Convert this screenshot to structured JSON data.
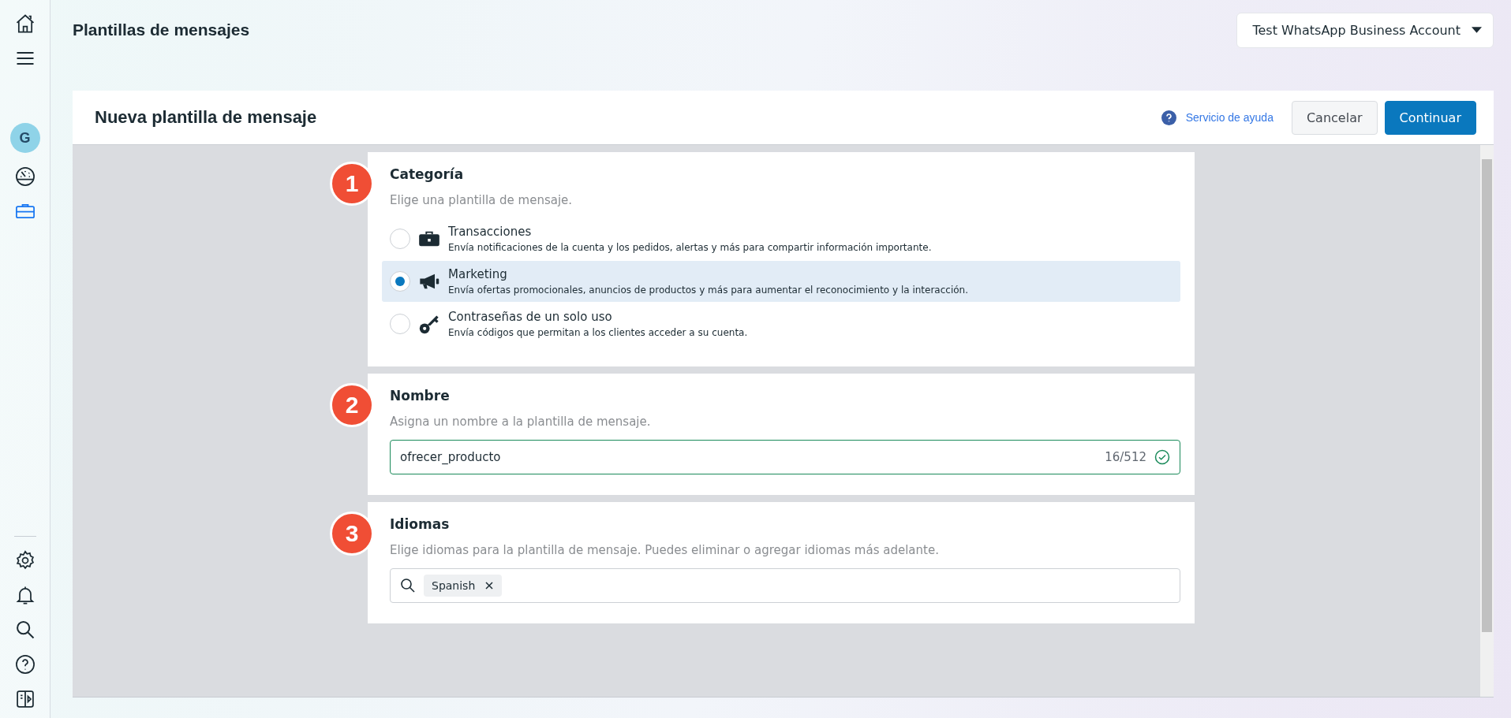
{
  "sidebar": {
    "avatar": "G",
    "items": [
      {
        "kind": "home",
        "selected": false
      },
      {
        "kind": "menu",
        "selected": false
      },
      {
        "kind": "gauge",
        "selected": false
      },
      {
        "kind": "toolbox",
        "selected": true
      }
    ],
    "bottom_items": [
      {
        "kind": "settings"
      },
      {
        "kind": "bell"
      },
      {
        "kind": "search"
      },
      {
        "kind": "help"
      },
      {
        "kind": "panel"
      }
    ]
  },
  "page_title": "Plantillas de mensajes",
  "account_selector": "Test WhatsApp Business Account",
  "card": {
    "title": "Nueva plantilla de mensaje",
    "help_link": "Servicio de ayuda",
    "buttons": [
      {
        "label": "Cancelar",
        "kind": "secondary"
      },
      {
        "label": "Continuar",
        "kind": "primary"
      }
    ]
  },
  "sections": [
    {
      "step": "1",
      "kind": "category",
      "title": "Categoría",
      "subtitle": "Elige una plantilla de mensaje.",
      "options": [
        {
          "kind": "briefcase",
          "label": "Transacciones",
          "description": "Envía notificaciones de la cuenta y los pedidos, alertas y más para compartir información importante.",
          "selected": false
        },
        {
          "kind": "megaphone",
          "label": "Marketing",
          "description": "Envía ofertas promocionales, anuncios de productos y más para aumentar el reconocimiento y la interacción.",
          "selected": true
        },
        {
          "kind": "key",
          "label": "Contraseñas de un solo uso",
          "description": "Envía códigos que permitan a los clientes acceder a su cuenta.",
          "selected": false
        }
      ]
    },
    {
      "step": "2",
      "kind": "name",
      "title": "Nombre",
      "subtitle": "Asigna un nombre a la plantilla de mensaje.",
      "value": "ofrecer_producto",
      "counter": "16/512",
      "valid": true
    },
    {
      "step": "3",
      "kind": "languages",
      "title": "Idiomas",
      "subtitle": "Elige idiomas para la plantilla de mensaje. Puedes eliminar o agregar idiomas más adelante.",
      "tags": [
        "Spanish"
      ]
    }
  ]
}
